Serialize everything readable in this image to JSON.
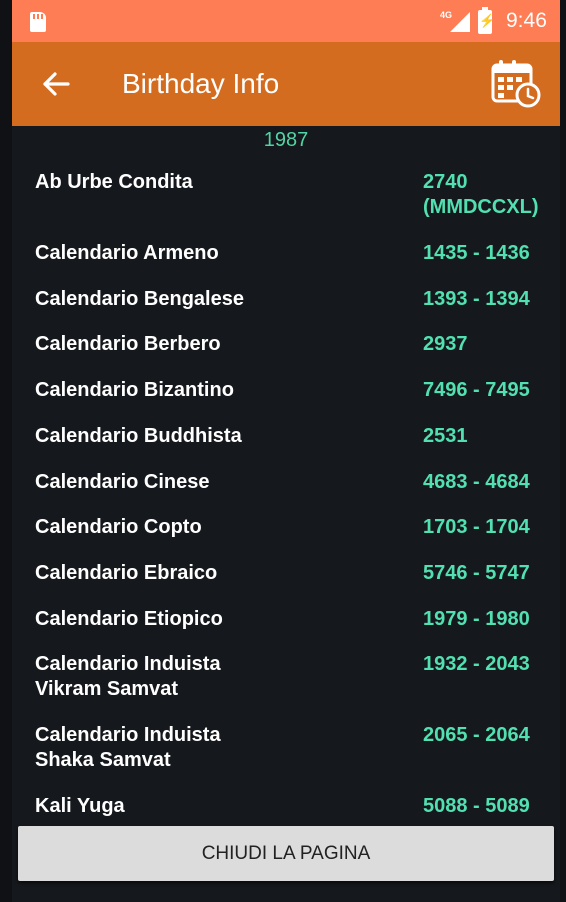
{
  "status_bar": {
    "network": "4G",
    "time": "9:46"
  },
  "app_bar": {
    "title": "Birthday Info",
    "back_icon": "arrow-left-icon",
    "action_icon": "calendar-clock-icon"
  },
  "year": "1987",
  "calendars": [
    {
      "name": "Ab Urbe Condita",
      "value": "2740\n(MMDCCXL)"
    },
    {
      "name": "Calendario Armeno",
      "value": "1435 - 1436"
    },
    {
      "name": "Calendario Bengalese",
      "value": "1393 - 1394"
    },
    {
      "name": "Calendario Berbero",
      "value": "2937"
    },
    {
      "name": "Calendario Bizantino",
      "value": "7496 - 7495"
    },
    {
      "name": "Calendario Buddhista",
      "value": "2531"
    },
    {
      "name": "Calendario Cinese",
      "value": "4683 - 4684"
    },
    {
      "name": "Calendario Copto",
      "value": "1703 - 1704"
    },
    {
      "name": "Calendario Ebraico",
      "value": "5746 - 5747"
    },
    {
      "name": "Calendario Etiopico",
      "value": "1979 - 1980"
    },
    {
      "name": "Calendario Induista\nVikram Samvat",
      "value": "1932 - 2043"
    },
    {
      "name": "Calendario Induista\nShaka Samvat",
      "value": "2065 - 2064"
    },
    {
      "name": "Kali Yuga",
      "value": "5088 - 5089"
    }
  ],
  "close_button": "CHIUDI LA PAGINA",
  "colors": {
    "status_bar": "#ff7d55",
    "app_bar": "#d46c20",
    "background": "#15181c",
    "accent_value": "#52e0b0"
  }
}
